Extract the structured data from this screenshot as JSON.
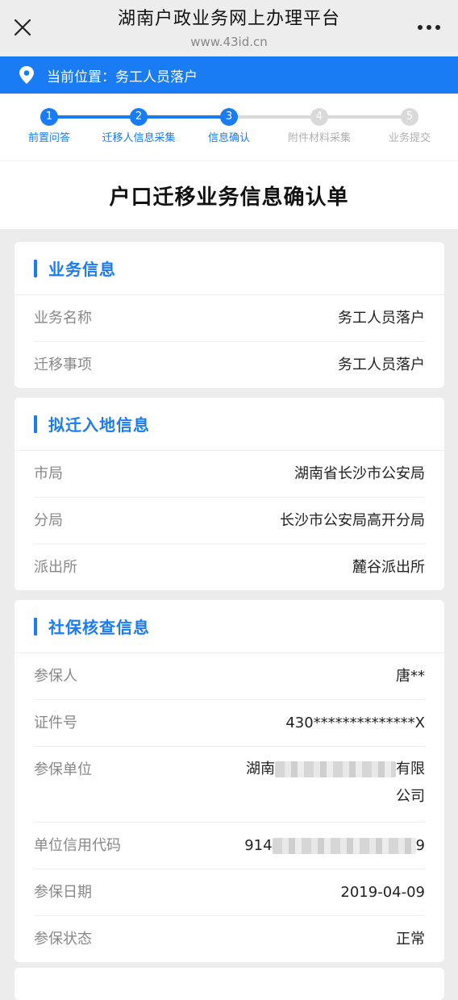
{
  "header": {
    "title": "湖南户政业务网上办理平台",
    "url": "www.43id.cn"
  },
  "location": {
    "text": "当前位置：务工人员落户"
  },
  "steps": [
    {
      "num": "1",
      "label": "前置问答",
      "state": "done"
    },
    {
      "num": "2",
      "label": "迁移人信息采集",
      "state": "done"
    },
    {
      "num": "3",
      "label": "信息确认",
      "state": "current"
    },
    {
      "num": "4",
      "label": "附件材料采集",
      "state": "todo"
    },
    {
      "num": "5",
      "label": "业务提交",
      "state": "todo"
    }
  ],
  "colors": {
    "accent": "#1a7cf5",
    "inactive": "#d9d9d9",
    "inactive_text": "#b0b0b0"
  },
  "page_title": "户口迁移业务信息确认单",
  "business": {
    "title": "业务信息",
    "rows": [
      {
        "label": "业务名称",
        "value": "务工人员落户"
      },
      {
        "label": "迁移事项",
        "value": "务工人员落户"
      }
    ]
  },
  "destination": {
    "title": "拟迁入地信息",
    "rows": [
      {
        "label": "市局",
        "value": "湖南省长沙市公安局"
      },
      {
        "label": "分局",
        "value": "长沙市公安局高开分局"
      },
      {
        "label": "派出所",
        "value": "麓谷派出所"
      }
    ]
  },
  "social": {
    "title": "社保核查信息",
    "insured_label": "参保人",
    "insured_value": "唐**",
    "id_label": "证件号",
    "id_value": "430**************X",
    "unit_label": "参保单位",
    "unit_prefix": "湖南",
    "unit_suffix": "有限",
    "unit_line2": "公司",
    "credit_label": "单位信用代码",
    "credit_prefix": "914",
    "credit_suffix": "9",
    "date_label": "参保日期",
    "date_value": "2019-04-09",
    "status_label": "参保状态",
    "status_value": "正常"
  }
}
